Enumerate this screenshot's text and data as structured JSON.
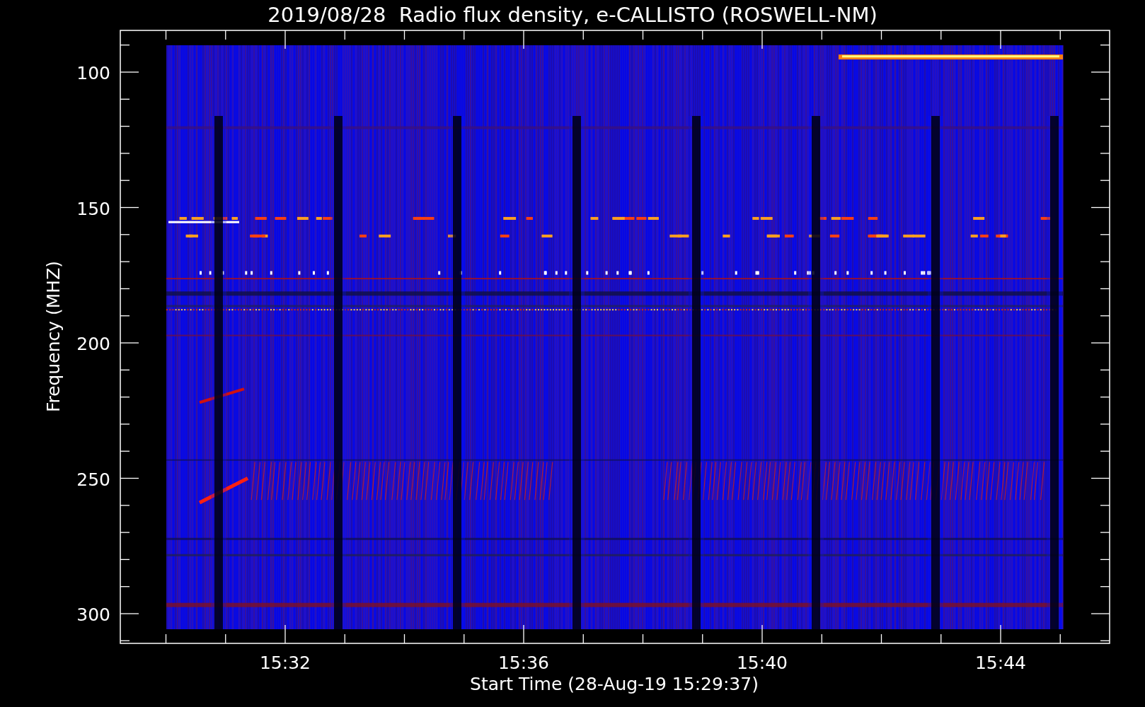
{
  "title": "2019/08/28  Radio flux density, e-CALLISTO (ROSWELL-NM)",
  "y_axis": {
    "label": "Frequency (MHZ)",
    "ticks": [
      "100",
      "150",
      "200",
      "250",
      "300"
    ]
  },
  "x_axis": {
    "label": "Start Time (28-Aug-19 15:29:37)",
    "ticks": [
      "15:32",
      "15:36",
      "15:40",
      "15:44"
    ]
  }
}
